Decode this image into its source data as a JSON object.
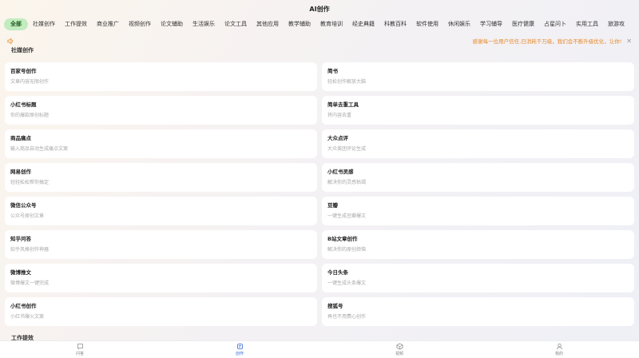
{
  "header": {
    "title": "AI创作"
  },
  "tabs": [
    "全部",
    "社媒创作",
    "工作提效",
    "商业推广",
    "视频创作",
    "论文辅助",
    "生活娱乐",
    "论文工具",
    "其他应用",
    "教学辅助",
    "教育培训",
    "经史典籍",
    "科教百科",
    "软件使用",
    "休闲娱乐",
    "学习辅导",
    "医疗健康",
    "占星问卜",
    "实用工具",
    "旅游攻"
  ],
  "notice": {
    "text": "感谢每一位用户信任,日消耗千万级，我们会不断升级优化，让你!",
    "icon": "speaker-icon",
    "close_icon": "close-icon",
    "color": "#e8892a"
  },
  "section": {
    "title": "社媒创作",
    "next_title": "工作提效"
  },
  "cards": [
    {
      "title": "百家号创作",
      "desc": "文章内容无限创作"
    },
    {
      "title": "简书",
      "desc": "轻松创作解放大脑"
    },
    {
      "title": "小红书标题",
      "desc": "你的爆款原创标题"
    },
    {
      "title": "简单去重工具",
      "desc": "将内容去重"
    },
    {
      "title": "商品痛点",
      "desc": "输入商品自动生成痛点文案"
    },
    {
      "title": "大众点评",
      "desc": "大众美团评论生成"
    },
    {
      "title": "网易创作",
      "desc": "轻轻松松帮你搞定"
    },
    {
      "title": "小红书灵感",
      "desc": "解决你的灵感枯竭"
    },
    {
      "title": "微信公众号",
      "desc": "公众号原创文章"
    },
    {
      "title": "豆瓣",
      "desc": "一键生成豆瓣爆文"
    },
    {
      "title": "知乎问答",
      "desc": "知乎风格创作神器"
    },
    {
      "title": "B站文章创作",
      "desc": "解决你的原创烦恼"
    },
    {
      "title": "微博推文",
      "desc": "微博爆文一键完成"
    },
    {
      "title": "今日头条",
      "desc": "一键生成头条爆文"
    },
    {
      "title": "小红书创作",
      "desc": "小红书爆火文案"
    },
    {
      "title": "搜狐号",
      "desc": "再也不用费心创作"
    }
  ],
  "bottom_nav": [
    {
      "label": "问答",
      "icon": "chat-icon",
      "active": false
    },
    {
      "label": "创作",
      "icon": "create-icon",
      "active": true
    },
    {
      "label": "视频",
      "icon": "video-icon",
      "active": false
    },
    {
      "label": "我的",
      "icon": "user-icon",
      "active": false
    }
  ],
  "colors": {
    "active_tab_bg": "#c2ecbf",
    "nav_active": "#2f65d8",
    "notice": "#e8892a"
  }
}
